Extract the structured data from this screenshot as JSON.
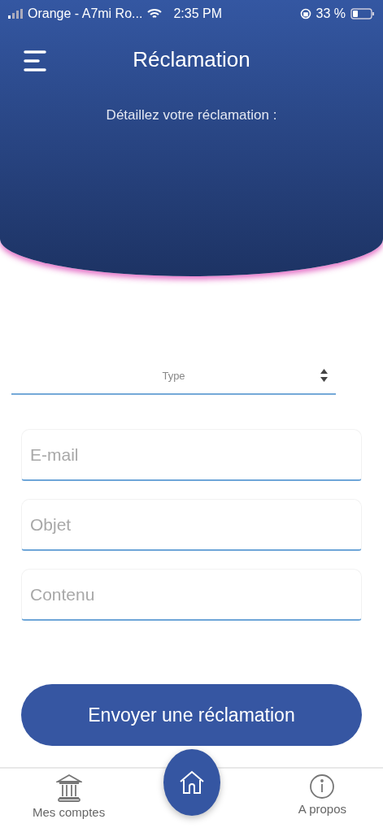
{
  "status_bar": {
    "carrier": "Orange - A7mi Ro...",
    "time": "2:35 PM",
    "battery": "33 %"
  },
  "header": {
    "title": "Réclamation",
    "subtitle": "Détaillez votre réclamation :"
  },
  "form": {
    "type_select": {
      "placeholder": "Type"
    },
    "fields": [
      {
        "placeholder": "E-mail"
      },
      {
        "placeholder": "Objet"
      },
      {
        "placeholder": "Contenu"
      }
    ],
    "submit": "Envoyer une réclamation"
  },
  "tab_bar": [
    {
      "kind": "accounts",
      "label": "Mes comptes"
    },
    {
      "kind": "home"
    },
    {
      "kind": "about",
      "label": "A propos"
    }
  ]
}
